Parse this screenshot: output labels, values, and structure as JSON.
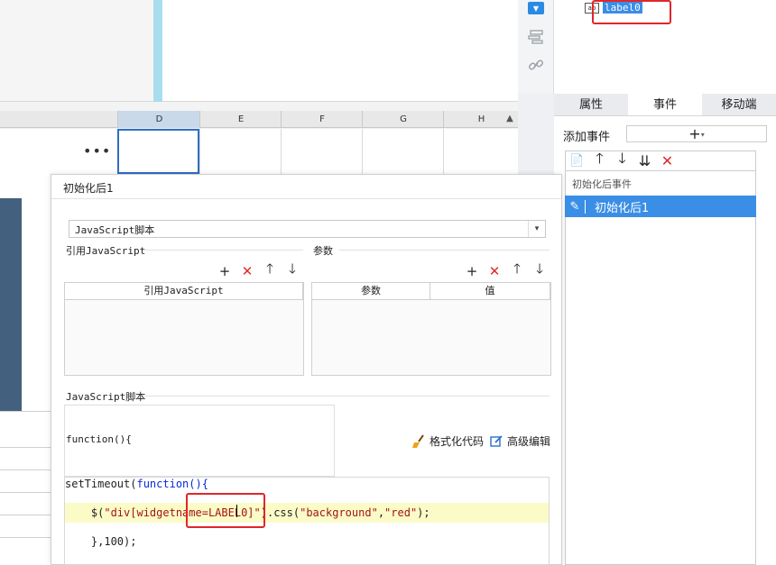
{
  "sheet": {
    "columns": [
      "D",
      "E",
      "F",
      "G",
      "H"
    ],
    "selected_column": "D",
    "more_label": "•••",
    "scroll_up": "▲"
  },
  "side_tools": {
    "dropdown_icon": "▼"
  },
  "widget_tree": {
    "selected_label": "label0"
  },
  "right_panel": {
    "tabs": [
      {
        "label": "属性",
        "active": false
      },
      {
        "label": "事件",
        "active": true
      },
      {
        "label": "移动端",
        "active": false
      }
    ],
    "add_event_label": "添加事件",
    "add_event_icon": "+",
    "add_event_caret": "▾",
    "event_tools": [
      "📄",
      "🡑",
      "🡓",
      "⇊",
      "✕"
    ],
    "event_group_label": "初始化后事件",
    "event_item_label": "初始化后1"
  },
  "dialog": {
    "title": "初始化后1",
    "script_type": "JavaScript脚本",
    "dropdown_arrow": "▾",
    "ref_js_label": "引用JavaScript",
    "params_label": "参数",
    "ref_js_tools": [
      "+",
      "✕",
      "🡑",
      "🡓"
    ],
    "params_tools": [
      "+",
      "✕",
      "🡑",
      "🡓"
    ],
    "ref_js_column": "引用JavaScript",
    "params_columns": [
      "参数",
      "值"
    ],
    "script_label": "JavaScript脚本",
    "fn_header": "function(){",
    "format_code_label": "格式化代码",
    "advanced_edit_label": "高级编辑",
    "code": {
      "line1_a": "setTimeout(",
      "line1_b": "function",
      "line1_c": "(){",
      "line2_a": "    $(",
      "line2_b": "\"div[widgetname=LABEL0]\"",
      "line2_c": ").css(",
      "line2_d": "\"background\"",
      "line2_e": ",",
      "line2_f": "\"red\"",
      "line2_g": ");",
      "line3": "    },100);"
    }
  },
  "colors": {
    "accent": "#3a8ee6",
    "highlight_red": "#e0262a"
  }
}
